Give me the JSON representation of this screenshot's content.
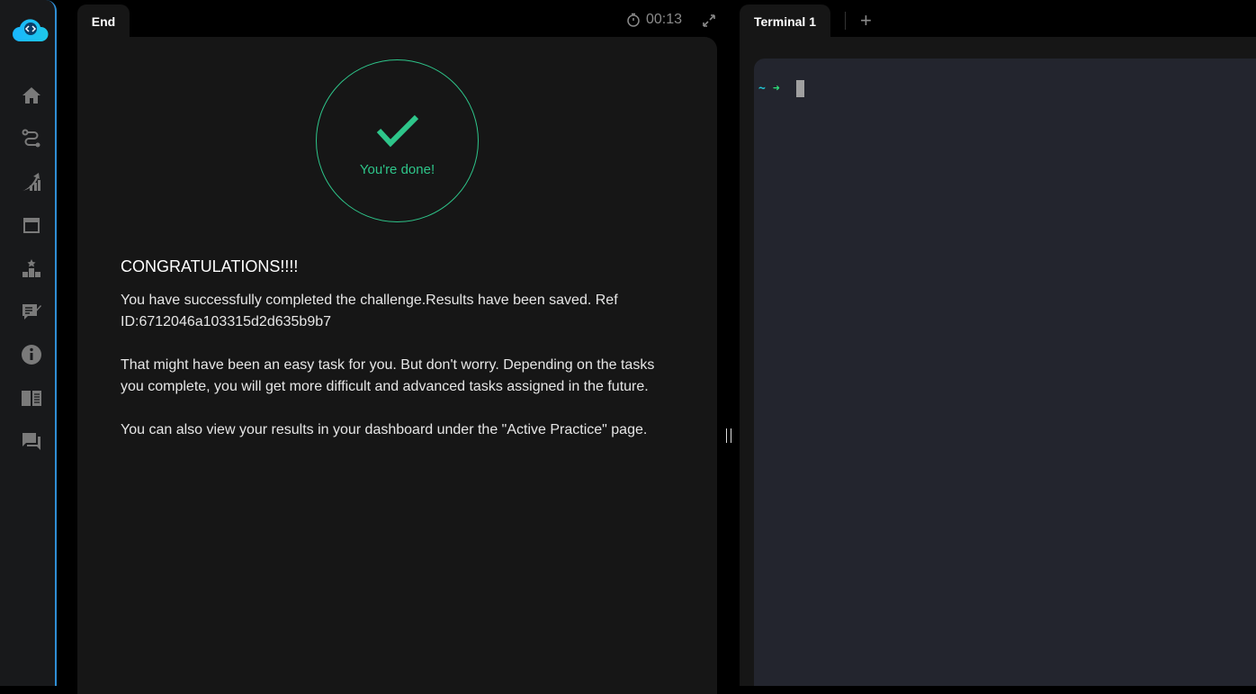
{
  "sidebar": {
    "items": [
      {
        "name": "home"
      },
      {
        "name": "roadmap"
      },
      {
        "name": "progress"
      },
      {
        "name": "calendar"
      },
      {
        "name": "leaderboard"
      },
      {
        "name": "feedback"
      },
      {
        "name": "info"
      },
      {
        "name": "docs"
      },
      {
        "name": "chat"
      }
    ]
  },
  "task_tab": {
    "label": "End"
  },
  "timer": {
    "value": "00:13"
  },
  "result": {
    "badge": "You're done!",
    "title": "CONGRATULATIONS!!!!",
    "paragraphs": [
      "You have successfully completed the challenge.Results have been saved. Ref ID:6712046a103315d2d635b9b7",
      "That might have been an easy task for you. But don't worry. Depending on the tasks you complete, you will get more difficult and advanced tasks assigned in the future.",
      "You can also view your results in your dashboard under the \"Active Practice\" page."
    ]
  },
  "terminal": {
    "tab_label": "Terminal 1",
    "add_label": "+",
    "prompt_tilde": "~",
    "prompt_arrow": "➜"
  },
  "colors": {
    "accent": "#2ec58a",
    "sidebar_border": "#2f8fd6",
    "terminal_bg": "#23252e"
  }
}
